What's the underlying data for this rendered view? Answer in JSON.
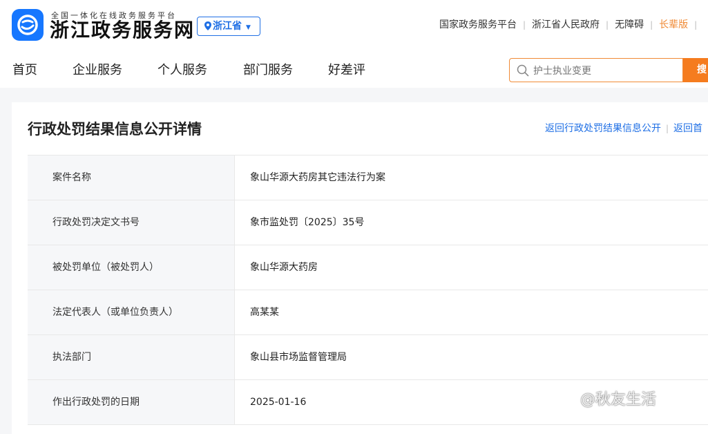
{
  "header": {
    "logo_subtitle": "全国一体化在线政务服务平台",
    "logo_title": "浙江政务服务网",
    "region": "浙江省",
    "top_links": [
      "国家政务服务平台",
      "浙江省人民政府",
      "无障碍",
      "长辈版"
    ],
    "accent_color": "#f57c1f",
    "brand_color": "#1677ff"
  },
  "nav": {
    "items": [
      "首页",
      "企业服务",
      "个人服务",
      "部门服务",
      "好差评"
    ]
  },
  "search": {
    "value": "",
    "placeholder": "护士执业变更",
    "button_label": "搜"
  },
  "page": {
    "title": "行政处罚结果信息公开详情",
    "back_links": [
      "返回行政处罚结果信息公开",
      "返回首"
    ]
  },
  "details": [
    {
      "label": "案件名称",
      "value": "象山华源大药房其它违法行为案"
    },
    {
      "label": "行政处罚决定文书号",
      "value": "象市监处罚〔2025〕35号"
    },
    {
      "label": "被处罚单位（被处罚人）",
      "value": "象山华源大药房"
    },
    {
      "label": "法定代表人（或单位负责人）",
      "value": "高某某"
    },
    {
      "label": "执法部门",
      "value": "象山县市场监督管理局"
    },
    {
      "label": "作出行政处罚的日期",
      "value": "2025-01-16"
    }
  ],
  "watermark": "@秋友生活"
}
